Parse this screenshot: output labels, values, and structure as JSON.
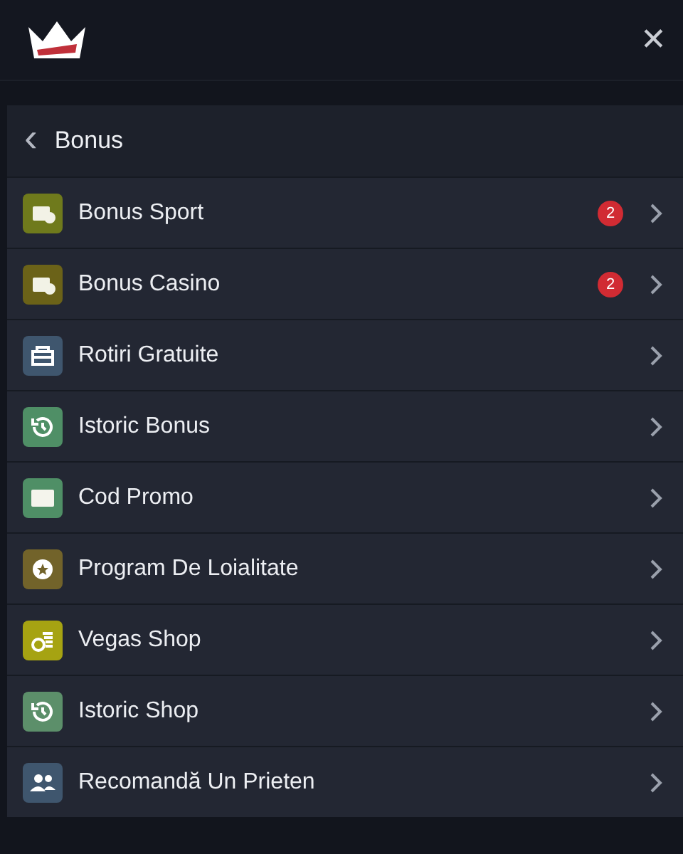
{
  "header": {
    "close": "✕"
  },
  "panel": {
    "back": "‹",
    "title": "Bonus",
    "items": [
      {
        "label": "Bonus Sport",
        "kind": "ticket",
        "color": "#6f7a1c",
        "badge": "2"
      },
      {
        "label": "Bonus Casino",
        "kind": "ticket",
        "color": "#6b6218",
        "badge": "2"
      },
      {
        "label": "Rotiri Gratuite",
        "kind": "gift",
        "color": "#3f566e"
      },
      {
        "label": "Istoric Bonus",
        "kind": "history",
        "color": "#4f8f66"
      },
      {
        "label": "Cod Promo",
        "kind": "coupon",
        "color": "#4f8f66"
      },
      {
        "label": "Program De Loialitate",
        "kind": "star",
        "color": "#72632a"
      },
      {
        "label": "Vegas Shop",
        "kind": "coins",
        "color": "#a6a312"
      },
      {
        "label": "Istoric Shop",
        "kind": "history",
        "color": "#5c8f6a"
      },
      {
        "label": "Recomandă Un Prieten",
        "kind": "people",
        "color": "#3f566e"
      }
    ]
  }
}
